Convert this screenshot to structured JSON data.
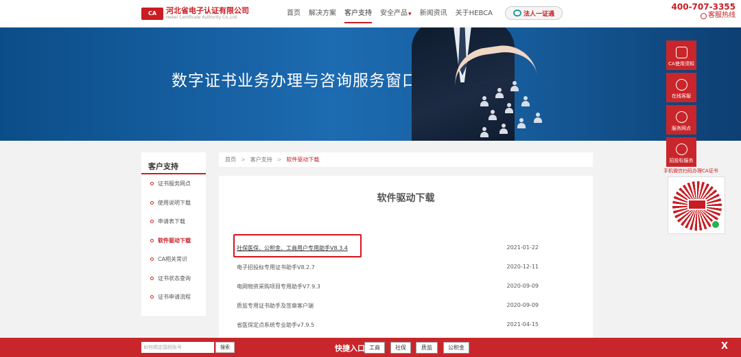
{
  "header": {
    "logo_mark": "CA",
    "logo_cn": "河北省电子认证有限公司",
    "logo_en": "Hebei Certificate Authority Co.,Ltd.",
    "nav": [
      "首页",
      "解决方案",
      "客户支持",
      "安全产品",
      "新闻资讯",
      "关于HEBCA"
    ],
    "legal_button": "法人一证通",
    "hotline_number": "400-707-3355",
    "hotline_label": "客服热线"
  },
  "banner": {
    "title": "数字证书业务办理与咨询服务窗口"
  },
  "sidebar": {
    "title": "客户支持",
    "items": [
      "证书服务网点",
      "使用说明下载",
      "申请表下载",
      "软件驱动下载",
      "CA相关常识",
      "证书状态查询",
      "证书申请流程"
    ]
  },
  "breadcrumb": {
    "home": "首页",
    "sep": ">",
    "section": "客户支持",
    "current": "软件驱动下载"
  },
  "content": {
    "title": "软件驱动下载",
    "downloads": [
      {
        "name": "社保医保、公积金、工商用户专用助手V8.3.4",
        "date": "2021-01-22"
      },
      {
        "name": "电子招投标专用证书助手V8.2.7",
        "date": "2020-12-11"
      },
      {
        "name": "电网物资采购项目专用助手V7.9.3",
        "date": "2020-09-09"
      },
      {
        "name": "质监专用证书助手及签章客户端",
        "date": "2020-09-09"
      },
      {
        "name": "省医保定点系统专业助手v7.9.5",
        "date": "2021-04-15"
      }
    ]
  },
  "float_bar": {
    "items": [
      "CA使用须知",
      "在线客服",
      "服务网点",
      "招投标服务"
    ],
    "qr_caption": "手机微信扫码办理CA证书"
  },
  "bottom_bar": {
    "search_placeholder": "如何绑定国税账号",
    "search_button": "搜索",
    "quick_label": "快捷入口",
    "quick_links": [
      "工商",
      "社保",
      "质监",
      "公积金"
    ],
    "close": "X"
  },
  "colors": {
    "brand_red": "#c81d23",
    "banner_blue": "#1d6bb1"
  }
}
